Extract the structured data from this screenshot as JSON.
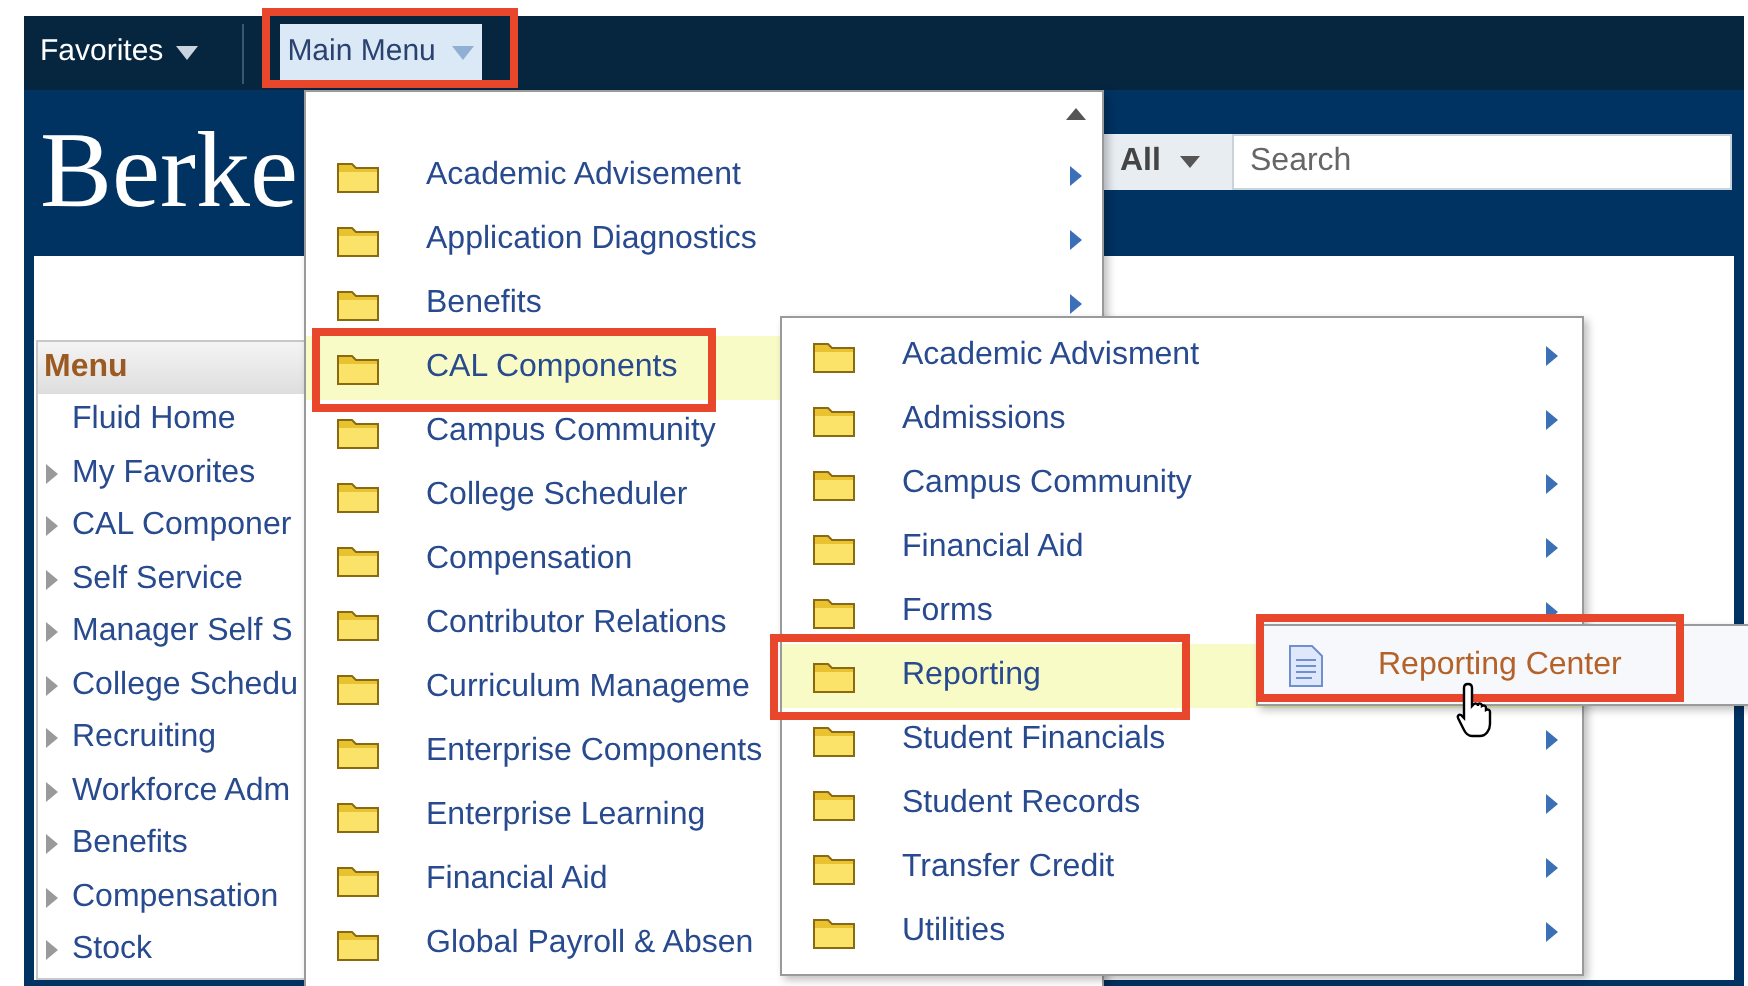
{
  "top_bar": {
    "favorites": "Favorites",
    "main_menu": {
      "label": "Main Menu",
      "open": true
    }
  },
  "header": {
    "logo": "Berke",
    "search": {
      "scope": "All",
      "placeholder": "Search"
    }
  },
  "sidebar": {
    "title": "Menu",
    "items": [
      {
        "label": "Fluid Home",
        "expandable": false
      },
      {
        "label": "My Favorites",
        "expandable": true
      },
      {
        "label": "CAL Componer",
        "expandable": true
      },
      {
        "label": "Self Service",
        "expandable": true
      },
      {
        "label": "Manager Self S",
        "expandable": true
      },
      {
        "label": "College Schedu",
        "expandable": true
      },
      {
        "label": "Recruiting",
        "expandable": true
      },
      {
        "label": "Workforce Adm",
        "expandable": true
      },
      {
        "label": "Benefits",
        "expandable": true
      },
      {
        "label": "Compensation",
        "expandable": true
      },
      {
        "label": "Stock",
        "expandable": true
      }
    ]
  },
  "main_menu": {
    "items": [
      {
        "label": "Academic Advisement",
        "selected": false,
        "arrow": true
      },
      {
        "label": "Application Diagnostics",
        "selected": false,
        "arrow": true
      },
      {
        "label": "Benefits",
        "selected": false,
        "arrow": true
      },
      {
        "label": "CAL Components",
        "selected": true,
        "arrow": false
      },
      {
        "label": "Campus Community",
        "selected": false
      },
      {
        "label": "College Scheduler",
        "selected": false
      },
      {
        "label": "Compensation",
        "selected": false
      },
      {
        "label": "Contributor Relations",
        "selected": false
      },
      {
        "label": "Curriculum Manageme",
        "selected": false
      },
      {
        "label": "Enterprise Components",
        "selected": false
      },
      {
        "label": "Enterprise Learning",
        "selected": false
      },
      {
        "label": "Financial Aid",
        "selected": false
      },
      {
        "label": "Global Payroll & Absen",
        "selected": false
      }
    ]
  },
  "submenu": {
    "items": [
      {
        "label": "Academic Advisment",
        "selected": false,
        "arrow": true
      },
      {
        "label": "Admissions",
        "selected": false,
        "arrow": true
      },
      {
        "label": "Campus Community",
        "selected": false,
        "arrow": true
      },
      {
        "label": "Financial Aid",
        "selected": false,
        "arrow": true
      },
      {
        "label": "Forms",
        "selected": false,
        "arrow": true
      },
      {
        "label": "Reporting",
        "selected": true,
        "arrow": false
      },
      {
        "label": "Student Financials",
        "selected": false,
        "arrow": true
      },
      {
        "label": "Student Records",
        "selected": false,
        "arrow": true
      },
      {
        "label": "Transfer Credit",
        "selected": false,
        "arrow": true
      },
      {
        "label": "Utilities",
        "selected": false,
        "arrow": true
      }
    ]
  },
  "flyout": {
    "items": [
      {
        "label": "Reporting Center",
        "selected": true
      }
    ]
  }
}
